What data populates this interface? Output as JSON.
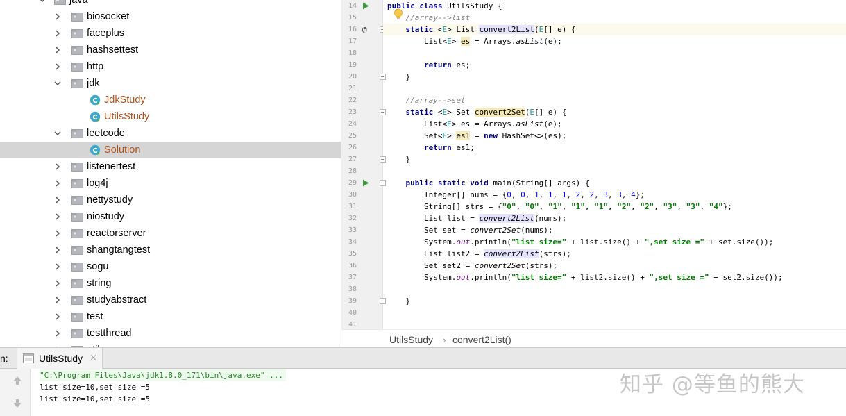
{
  "project_tree": {
    "top_partial_label": "java",
    "items": [
      {
        "label": "biosocket",
        "type": "package",
        "expanded": false,
        "indent": 0
      },
      {
        "label": "faceplus",
        "type": "package",
        "expanded": false,
        "indent": 0
      },
      {
        "label": "hashsettest",
        "type": "package",
        "expanded": false,
        "indent": 0
      },
      {
        "label": "http",
        "type": "package",
        "expanded": false,
        "indent": 0
      },
      {
        "label": "jdk",
        "type": "package",
        "expanded": true,
        "indent": 0
      },
      {
        "label": "JdkStudy",
        "type": "class",
        "indent": 1
      },
      {
        "label": "UtilsStudy",
        "type": "class",
        "indent": 1
      },
      {
        "label": "leetcode",
        "type": "package",
        "expanded": true,
        "indent": 0
      },
      {
        "label": "Solution",
        "type": "class",
        "indent": 1,
        "selected": true
      },
      {
        "label": "listenertest",
        "type": "package",
        "expanded": false,
        "indent": 0
      },
      {
        "label": "log4j",
        "type": "package",
        "expanded": false,
        "indent": 0
      },
      {
        "label": "nettystudy",
        "type": "package",
        "expanded": false,
        "indent": 0
      },
      {
        "label": "niostudy",
        "type": "package",
        "expanded": false,
        "indent": 0
      },
      {
        "label": "reactorserver",
        "type": "package",
        "expanded": false,
        "indent": 0
      },
      {
        "label": "shangtangtest",
        "type": "package",
        "expanded": false,
        "indent": 0
      },
      {
        "label": "sogu",
        "type": "package",
        "expanded": false,
        "indent": 0
      },
      {
        "label": "string",
        "type": "package",
        "expanded": false,
        "indent": 0
      },
      {
        "label": "studyabstract",
        "type": "package",
        "expanded": false,
        "indent": 0
      },
      {
        "label": "test",
        "type": "package",
        "expanded": false,
        "indent": 0
      },
      {
        "label": "testthread",
        "type": "package",
        "expanded": false,
        "indent": 0
      }
    ],
    "bottom_partial_label": "util"
  },
  "editor": {
    "current_line": 16,
    "lines": [
      {
        "n": "14",
        "code": "public class UtilsStudy {",
        "gutter": "run"
      },
      {
        "n": "15",
        "code": "    //array-->list",
        "gutter": ""
      },
      {
        "n": "16",
        "code": "    static <E> List convert2List(E[] e) {",
        "gutter": "override"
      },
      {
        "n": "17",
        "code": "        List<E> es = Arrays.asList(e);",
        "gutter": ""
      },
      {
        "n": "18",
        "code": "",
        "gutter": ""
      },
      {
        "n": "19",
        "code": "        return es;",
        "gutter": ""
      },
      {
        "n": "20",
        "code": "    }",
        "gutter": ""
      },
      {
        "n": "21",
        "code": "",
        "gutter": ""
      },
      {
        "n": "22",
        "code": "    //array-->set",
        "gutter": ""
      },
      {
        "n": "23",
        "code": "    static <E> Set convert2Set(E[] e) {",
        "gutter": ""
      },
      {
        "n": "24",
        "code": "        List<E> es = Arrays.asList(e);",
        "gutter": ""
      },
      {
        "n": "25",
        "code": "        Set<E> es1 = new HashSet<>(es);",
        "gutter": ""
      },
      {
        "n": "26",
        "code": "        return es1;",
        "gutter": ""
      },
      {
        "n": "27",
        "code": "    }",
        "gutter": ""
      },
      {
        "n": "28",
        "code": "",
        "gutter": ""
      },
      {
        "n": "29",
        "code": "    public static void main(String[] args) {",
        "gutter": "run"
      },
      {
        "n": "30",
        "code": "        Integer[] nums = {0, 0, 1, 1, 1, 2, 2, 3, 3, 4};",
        "gutter": ""
      },
      {
        "n": "31",
        "code": "        String[] strs = {\"0\", \"0\", \"1\", \"1\", \"1\", \"2\", \"2\", \"3\", \"3\", \"4\"};",
        "gutter": ""
      },
      {
        "n": "32",
        "code": "        List list = convert2List(nums);",
        "gutter": ""
      },
      {
        "n": "33",
        "code": "        Set set = convert2Set(nums);",
        "gutter": ""
      },
      {
        "n": "34",
        "code": "        System.out.println(\"list size=\" + list.size() + \",set size =\" + set.size());",
        "gutter": ""
      },
      {
        "n": "35",
        "code": "        List list2 = convert2List(strs);",
        "gutter": ""
      },
      {
        "n": "36",
        "code": "        Set set2 = convert2Set(strs);",
        "gutter": ""
      },
      {
        "n": "37",
        "code": "        System.out.println(\"list size=\" + list2.size() + \",set size =\" + set2.size());",
        "gutter": ""
      },
      {
        "n": "38",
        "code": "",
        "gutter": ""
      },
      {
        "n": "39",
        "code": "    }",
        "gutter": ""
      },
      {
        "n": "40",
        "code": "",
        "gutter": ""
      },
      {
        "n": "41",
        "code": "",
        "gutter": ""
      }
    ]
  },
  "breadcrumb": {
    "class": "UtilsStudy",
    "separator": "›",
    "method": "convert2List()"
  },
  "run_panel": {
    "label": "n:",
    "tab_label": "UtilsStudy",
    "tab_close": "×",
    "console_lines": [
      "\"C:\\Program Files\\Java\\jdk1.8.0_171\\bin\\java.exe\" ...",
      "list size=10,set size =5",
      "list size=10,set size =5"
    ]
  },
  "watermark": "知乎 @等鱼的熊大",
  "colors": {
    "keyword": "#000080",
    "string": "#008000",
    "number": "#0000ff",
    "comment": "#808080",
    "class_label": "#b0521b",
    "selection": "#d5d5d5"
  }
}
